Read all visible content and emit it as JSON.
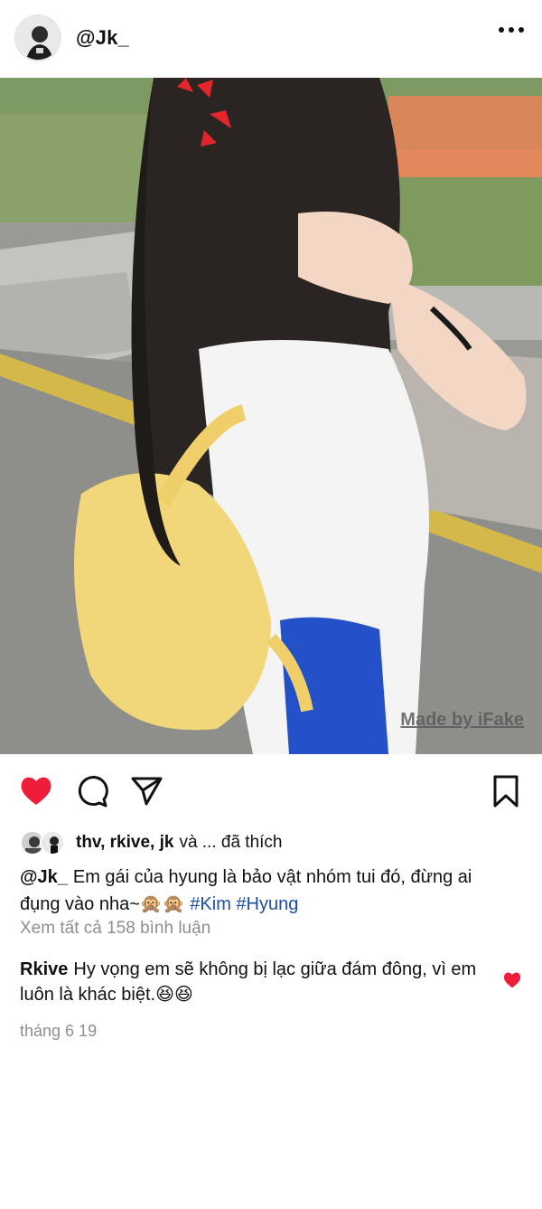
{
  "post": {
    "username": "@Jk_",
    "watermark": "Made by iFake",
    "likes": {
      "names": "thv, rkive, jk",
      "rest": "và ... đã thích"
    },
    "caption": {
      "username": "@Jk_",
      "text": "Em gái của hyung là bảo vật nhóm tui đó, đừng ai đụng vào nha~🙊🙊",
      "hashtags": [
        "#Kim",
        "#Hyung"
      ]
    },
    "view_comments": "Xem tất cả 158 bình luận",
    "comment": {
      "username": "Rkive",
      "text": "Hy vọng em sẽ không bị lạc giữa đám đông, vì em luôn là khác biệt.😆😆"
    },
    "date": "tháng 6 19"
  },
  "icons": {
    "like": "heart-icon",
    "comment": "comment-icon",
    "share": "send-icon",
    "save": "bookmark-icon",
    "more": "more-options-icon"
  },
  "colors": {
    "like_active": "#ee1d3a",
    "hashtag": "#1f4fa3",
    "muted": "#8e8e8e"
  }
}
